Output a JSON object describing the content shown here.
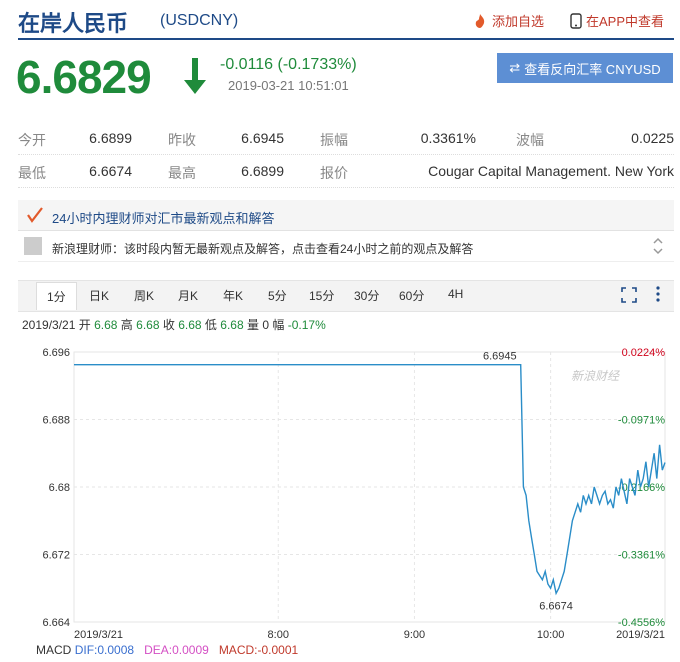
{
  "header": {
    "title": "在岸人民币",
    "code": "(USDCNY)",
    "add_fav": "添加自选",
    "in_app": "在APP中查看"
  },
  "quote": {
    "price": "6.6829",
    "change": "-0.0116 (-0.1733%)",
    "datetime": "2019-03-21 10:51:01",
    "reverse_button": "查看反向汇率 CNYUSD",
    "down_color": "#1f8b3b"
  },
  "stats": {
    "open_label": "今开",
    "open": "6.6899",
    "prev_close_label": "昨收",
    "prev_close": "6.6945",
    "amplitude_label": "振幅",
    "amplitude": "0.3361%",
    "wave_label": "波幅",
    "wave": "0.0225",
    "low_label": "最低",
    "low": "6.6674",
    "high_label": "最高",
    "high": "6.6899",
    "quote_by_label": "报价",
    "quote_by": "Cougar Capital Management. New York"
  },
  "expert": {
    "title": "24小时内理财师对汇市最新观点和解答",
    "message": "新浪理财师：该时段内暂无最新观点及解答，点击查看24小时之前的观点及解答"
  },
  "tabs": [
    "1分",
    "日K",
    "周K",
    "月K",
    "年K",
    "5分",
    "15分",
    "30分",
    "60分",
    "4H"
  ],
  "ohlc": {
    "date": "2019/3/21",
    "open_label": "开",
    "open": "6.68",
    "high_label": "高",
    "high": "6.68",
    "close_label": "收",
    "close": "6.68",
    "low_label": "低",
    "low": "6.68",
    "vol_label": "量",
    "vol": "0",
    "amp_label": "幅",
    "amp": "-0.17%"
  },
  "chart_data": {
    "type": "line",
    "y_ticks": [
      "6.696",
      "6.688",
      "6.68",
      "6.672",
      "6.664"
    ],
    "ylim": [
      6.664,
      6.696
    ],
    "pct_ticks": [
      "0.0224%",
      "-0.0971%",
      "-0.2166%",
      "-0.3361%",
      "-0.4556%"
    ],
    "x_ticks": [
      "2019/3/21",
      "8:00",
      "9:00",
      "10:00",
      "2019/3/21"
    ],
    "annotations": {
      "high": "6.6945",
      "low": "6.6674"
    },
    "watermark": "新浪财经",
    "series": [
      {
        "x": [
          6.5,
          9.78,
          9.8,
          9.82,
          9.84,
          9.86,
          9.88,
          9.9,
          9.92,
          9.94,
          9.96,
          9.98,
          10.0,
          10.02,
          10.04,
          10.06,
          10.08,
          10.1,
          10.12,
          10.14,
          10.16,
          10.18,
          10.2,
          10.22,
          10.24,
          10.26,
          10.28,
          10.3,
          10.32,
          10.34,
          10.36,
          10.38,
          10.4,
          10.42,
          10.44,
          10.46,
          10.48,
          10.5,
          10.52,
          10.54,
          10.56,
          10.58,
          10.6,
          10.62,
          10.64,
          10.66,
          10.68,
          10.7,
          10.72,
          10.74,
          10.76,
          10.78,
          10.8,
          10.82,
          10.84
        ],
        "y": [
          6.6945,
          6.6945,
          6.68,
          6.679,
          6.676,
          6.674,
          6.672,
          6.67,
          6.6695,
          6.669,
          6.67,
          6.6685,
          6.668,
          6.669,
          6.6674,
          6.668,
          6.669,
          6.67,
          6.672,
          6.674,
          6.676,
          6.677,
          6.678,
          6.677,
          6.679,
          6.678,
          6.679,
          6.678,
          6.68,
          6.679,
          6.678,
          6.679,
          6.6795,
          6.678,
          6.6785,
          6.6775,
          6.68,
          6.679,
          6.681,
          6.6795,
          6.678,
          6.681,
          6.68,
          6.679,
          6.682,
          6.68,
          6.681,
          6.683,
          6.68,
          6.682,
          6.684,
          6.681,
          6.685,
          6.682,
          6.6829
        ]
      }
    ]
  },
  "macd": {
    "name": "MACD",
    "dif_label": "DIF:",
    "dif": "0.0008",
    "dea_label": "DEA:",
    "dea": "0.0009",
    "macd_label": "MACD:",
    "macd": "-0.0001"
  }
}
